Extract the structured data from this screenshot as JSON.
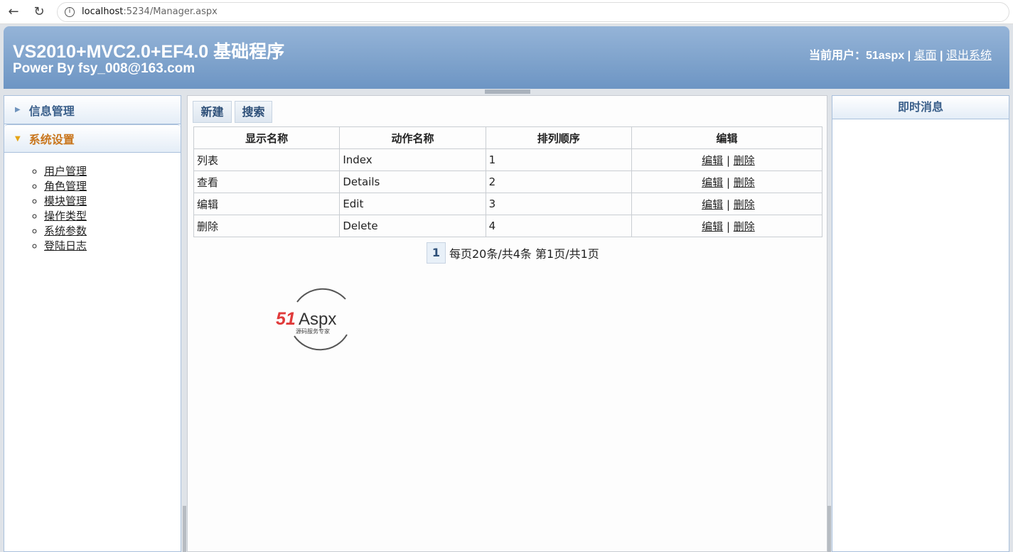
{
  "browser": {
    "host": "localhost",
    "path": ":5234/Manager.aspx"
  },
  "header": {
    "title": "VS2010+MVC2.0+EF4.0 基础程序",
    "subtitle": "Power By fsy_008@163.com",
    "user_prefix": "当前用户：51aspx | ",
    "desktop": "桌面",
    "sep": " | ",
    "logout": "退出系统"
  },
  "sidebar": {
    "sections": [
      {
        "label": "信息管理"
      },
      {
        "label": "系统设置"
      }
    ],
    "items": [
      "用户管理",
      "角色管理",
      "模块管理",
      "操作类型",
      "系统参数",
      "登陆日志"
    ]
  },
  "toolbar": {
    "new": "新建",
    "search": "搜索"
  },
  "table": {
    "headers": [
      "显示名称",
      "动作名称",
      "排列顺序",
      "编辑"
    ],
    "rows": [
      [
        "列表",
        "Index",
        "1"
      ],
      [
        "查看",
        "Details",
        "2"
      ],
      [
        "编辑",
        "Edit",
        "3"
      ],
      [
        "删除",
        "Delete",
        "4"
      ]
    ],
    "edit": "编辑",
    "delete": "删除",
    "sep": "|"
  },
  "pager": {
    "page": "1",
    "info": "每页20条/共4条 第1页/共1页"
  },
  "logo": {
    "text": "51Aspx",
    "tagline": "源码服务专家"
  },
  "right": {
    "title": "即时消息"
  }
}
